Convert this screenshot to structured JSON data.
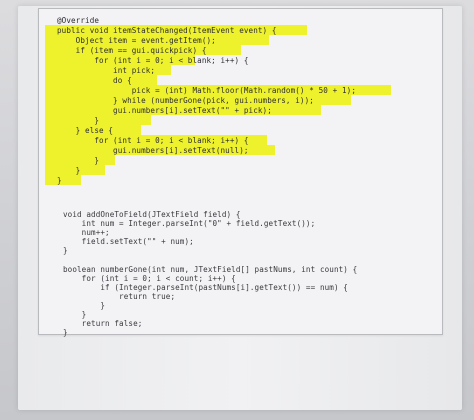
{
  "code": {
    "method1": [
      "@Override",
      "public void itemStateChanged(ItemEvent event) {",
      "    Object item = event.getItem();",
      "    if (item == gui.quickpick) {",
      "        for (int i = 0; i < blank; i++) {",
      "            int pick;",
      "            do {",
      "                pick = (int) Math.floor(Math.random() * 50 + 1);",
      "            } while (numberGone(pick, gui.numbers, i));",
      "            gui.numbers[i].setText(\"\" + pick);",
      "        }",
      "    } else {",
      "        for (int i = 0; i < blank; i++) {",
      "            gui.numbers[i].setText(null);",
      "        }",
      "    }",
      "}"
    ],
    "method2": [
      "void addOneToField(JTextField field) {",
      "    int num = Integer.parseInt(\"0\" + field.getText());",
      "    num++;",
      "    field.setText(\"\" + num);",
      "}"
    ],
    "method3": [
      "boolean numberGone(int num, JTextField[] pastNums, int count) {",
      "    for (int i = 0; i < count; i++) {",
      "        if (Integer.parseInt(pastNums[i].getText()) == num) {",
      "            return true;",
      "        }",
      "    }",
      "    return false;",
      "}"
    ]
  }
}
